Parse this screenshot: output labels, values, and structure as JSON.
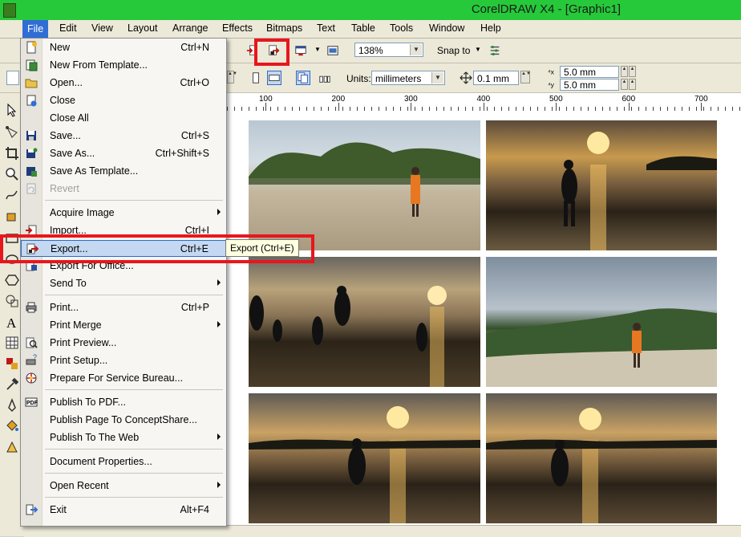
{
  "window": {
    "title": "CorelDRAW X4 - [Graphic1]"
  },
  "menubar": [
    {
      "label": "File",
      "active": true
    },
    {
      "label": "Edit"
    },
    {
      "label": "View"
    },
    {
      "label": "Layout"
    },
    {
      "label": "Arrange"
    },
    {
      "label": "Effects"
    },
    {
      "label": "Bitmaps"
    },
    {
      "label": "Text"
    },
    {
      "label": "Table"
    },
    {
      "label": "Tools"
    },
    {
      "label": "Window"
    },
    {
      "label": "Help"
    }
  ],
  "toolbar": {
    "zoom_value": "138%",
    "snap_label": "Snap to",
    "units_label": "Units:",
    "units_value": "millimeters",
    "nudge_value": "0.1 mm",
    "dup_x_value": "5.0 mm",
    "dup_y_value": "5.0 mm"
  },
  "ruler": {
    "numbers": [
      "100",
      "200",
      "300",
      "400",
      "500",
      "600",
      "700"
    ]
  },
  "file_menu": {
    "items": [
      {
        "label": "New",
        "shortcut": "Ctrl+N",
        "icon": "new-document-icon"
      },
      {
        "label": "New From Template...",
        "shortcut": "",
        "icon": "new-from-template-icon"
      },
      {
        "label": "Open...",
        "shortcut": "Ctrl+O",
        "icon": "open-folder-icon"
      },
      {
        "label": "Close",
        "shortcut": "",
        "icon": "close-document-icon"
      },
      {
        "label": "Close All",
        "shortcut": "",
        "icon": ""
      },
      {
        "label": "Save...",
        "shortcut": "Ctrl+S",
        "icon": "save-icon"
      },
      {
        "label": "Save As...",
        "shortcut": "Ctrl+Shift+S",
        "icon": "save-as-icon"
      },
      {
        "label": "Save As Template...",
        "shortcut": "",
        "icon": "save-template-icon"
      },
      {
        "label": "Revert",
        "shortcut": "",
        "icon": "revert-icon",
        "disabled": true
      },
      {
        "label": "Acquire Image",
        "shortcut": "",
        "icon": "",
        "submenu": true
      },
      {
        "label": "Import...",
        "shortcut": "Ctrl+I",
        "icon": "import-icon"
      },
      {
        "label": "Export...",
        "shortcut": "Ctrl+E",
        "icon": "export-icon",
        "highlighted": true
      },
      {
        "label": "Export For Office...",
        "shortcut": "",
        "icon": "export-office-icon"
      },
      {
        "label": "Send To",
        "shortcut": "",
        "icon": "",
        "submenu": true
      },
      {
        "label": "Print...",
        "shortcut": "Ctrl+P",
        "icon": "print-icon"
      },
      {
        "label": "Print Merge",
        "shortcut": "",
        "icon": "",
        "submenu": true
      },
      {
        "label": "Print Preview...",
        "shortcut": "",
        "icon": "print-preview-icon"
      },
      {
        "label": "Print Setup...",
        "shortcut": "",
        "icon": "print-setup-icon"
      },
      {
        "label": "Prepare For Service Bureau...",
        "shortcut": "",
        "icon": "service-bureau-icon"
      },
      {
        "label": "Publish To PDF...",
        "shortcut": "",
        "icon": "pdf-icon"
      },
      {
        "label": "Publish Page To ConceptShare...",
        "shortcut": "",
        "icon": ""
      },
      {
        "label": "Publish To The Web",
        "shortcut": "",
        "icon": "",
        "submenu": true
      },
      {
        "label": "Document Properties...",
        "shortcut": "",
        "icon": ""
      },
      {
        "label": "Open Recent",
        "shortcut": "",
        "icon": "",
        "submenu": true
      },
      {
        "label": "Exit",
        "shortcut": "Alt+F4",
        "icon": "exit-icon"
      }
    ]
  },
  "tooltip": {
    "text": "Export (Ctrl+E)"
  },
  "colors": {
    "title_bar": "#26c93a",
    "menu_highlight": "#c4d8f1",
    "annotation_red": "#e8161d",
    "menubar_active": "#2f6ed4"
  }
}
